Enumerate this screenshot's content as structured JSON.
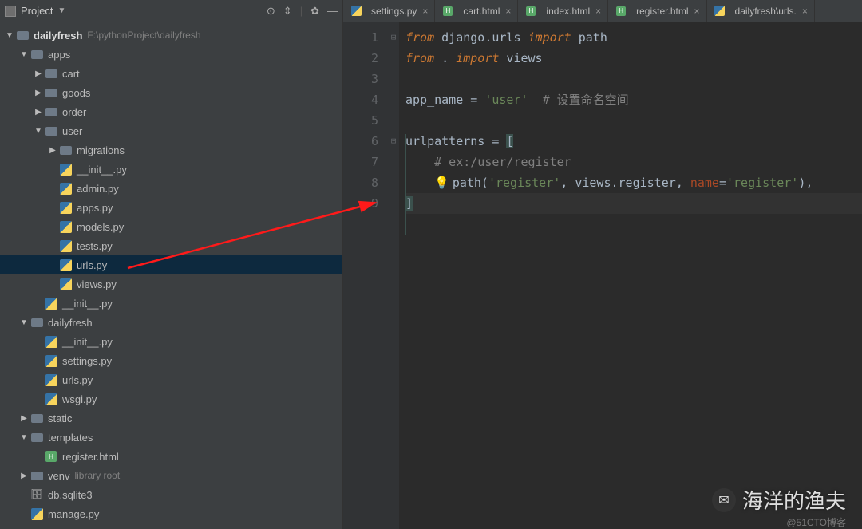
{
  "sidebar": {
    "title": "Project",
    "project_name": "dailyfresh",
    "project_path": "F:\\pythonProject\\dailyfresh",
    "tree": [
      {
        "label": "apps",
        "type": "folder",
        "depth": 1,
        "expanded": true
      },
      {
        "label": "cart",
        "type": "folder",
        "depth": 2,
        "expanded": false
      },
      {
        "label": "goods",
        "type": "folder",
        "depth": 2,
        "expanded": false
      },
      {
        "label": "order",
        "type": "folder",
        "depth": 2,
        "expanded": false
      },
      {
        "label": "user",
        "type": "folder",
        "depth": 2,
        "expanded": true
      },
      {
        "label": "migrations",
        "type": "folder",
        "depth": 3,
        "expanded": false
      },
      {
        "label": "__init__.py",
        "type": "py",
        "depth": 3
      },
      {
        "label": "admin.py",
        "type": "py",
        "depth": 3
      },
      {
        "label": "apps.py",
        "type": "py",
        "depth": 3
      },
      {
        "label": "models.py",
        "type": "py",
        "depth": 3
      },
      {
        "label": "tests.py",
        "type": "py",
        "depth": 3
      },
      {
        "label": "urls.py",
        "type": "py",
        "depth": 3,
        "selected": true
      },
      {
        "label": "views.py",
        "type": "py",
        "depth": 3
      },
      {
        "label": "__init__.py",
        "type": "py",
        "depth": 2
      },
      {
        "label": "dailyfresh",
        "type": "folder",
        "depth": 1,
        "expanded": true
      },
      {
        "label": "__init__.py",
        "type": "py",
        "depth": 2
      },
      {
        "label": "settings.py",
        "type": "py",
        "depth": 2
      },
      {
        "label": "urls.py",
        "type": "py",
        "depth": 2
      },
      {
        "label": "wsgi.py",
        "type": "py",
        "depth": 2
      },
      {
        "label": "static",
        "type": "folder",
        "depth": 1,
        "expanded": false
      },
      {
        "label": "templates",
        "type": "folder",
        "depth": 1,
        "expanded": true
      },
      {
        "label": "register.html",
        "type": "html",
        "depth": 2
      },
      {
        "label": "venv",
        "type": "folder",
        "depth": 1,
        "expanded": false,
        "suffix": "library root"
      },
      {
        "label": "db.sqlite3",
        "type": "db",
        "depth": 1
      },
      {
        "label": "manage.py",
        "type": "py",
        "depth": 1
      }
    ]
  },
  "tabs": [
    {
      "label": "settings.py",
      "icon": "py"
    },
    {
      "label": "cart.html",
      "icon": "html"
    },
    {
      "label": "index.html",
      "icon": "html"
    },
    {
      "label": "register.html",
      "icon": "html"
    },
    {
      "label": "dailyfresh\\urls.",
      "icon": "py"
    }
  ],
  "code": {
    "lines": [
      "1",
      "2",
      "3",
      "4",
      "5",
      "6",
      "7",
      "8",
      "9"
    ],
    "l1_from": "from",
    "l1_mod": " django.urls ",
    "l1_import": "import",
    "l1_name": " path",
    "l2_from": "from",
    "l2_mod": " . ",
    "l2_import": "import",
    "l2_name": " views",
    "l4_var": "app_name ",
    "l4_eq": "= ",
    "l4_str": "'user'",
    "l4_cmt": "  # 设置命名空间",
    "l6_var": "urlpatterns ",
    "l6_eq": "= ",
    "l6_br": "[",
    "l7_cmt": "    # ex:/user/register",
    "l8_indent": "    ",
    "l8_fn": "path(",
    "l8_str1": "'register'",
    "l8_c1": ", views.register, ",
    "l8_param": "name",
    "l8_eq2": "=",
    "l8_str2": "'register'",
    "l8_end": "),",
    "l9_br": "]"
  },
  "watermark": "海洋的渔夫",
  "watermark2": "@51CTO博客"
}
